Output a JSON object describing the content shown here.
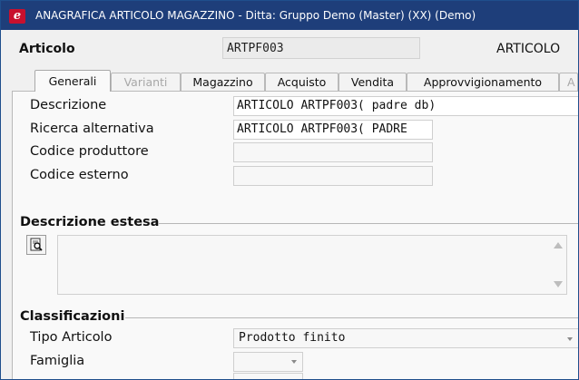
{
  "window": {
    "title": "ANAGRAFICA ARTICOLO MAGAZZINO - Ditta: Gruppo Demo (Master) (XX)  (Demo)",
    "app_icon": "e"
  },
  "header": {
    "label": "Articolo",
    "code": "ARTPF003",
    "right_text": "ARTICOLO"
  },
  "tabs": [
    {
      "label": "Generali",
      "active": true,
      "disabled": false
    },
    {
      "label": "Varianti",
      "active": false,
      "disabled": true
    },
    {
      "label": "Magazzino",
      "active": false,
      "disabled": false
    },
    {
      "label": "Acquisto",
      "active": false,
      "disabled": false
    },
    {
      "label": "Vendita",
      "active": false,
      "disabled": false
    },
    {
      "label": "Approvvigionamento",
      "active": false,
      "disabled": false
    },
    {
      "label": "A",
      "active": false,
      "disabled": true
    }
  ],
  "fields": {
    "descrizione": {
      "label": "Descrizione",
      "value": "ARTICOLO ARTPF003( padre db)"
    },
    "ricerca": {
      "label": "Ricerca alternativa",
      "value": "ARTICOLO ARTPF003( PADRE"
    },
    "produttore": {
      "label": "Codice produttore",
      "value": ""
    },
    "esterno": {
      "label": "Codice esterno",
      "value": ""
    }
  },
  "descrizione_estesa": {
    "title": "Descrizione estesa",
    "value": ""
  },
  "classificazioni": {
    "title": "Classificazioni",
    "tipo": {
      "label": "Tipo Articolo",
      "value": "Prodotto finito"
    },
    "famiglia": {
      "label": "Famiglia",
      "value": ""
    }
  },
  "colors": {
    "titlebar": "#1e3e7a",
    "brand": "#c8102e"
  }
}
